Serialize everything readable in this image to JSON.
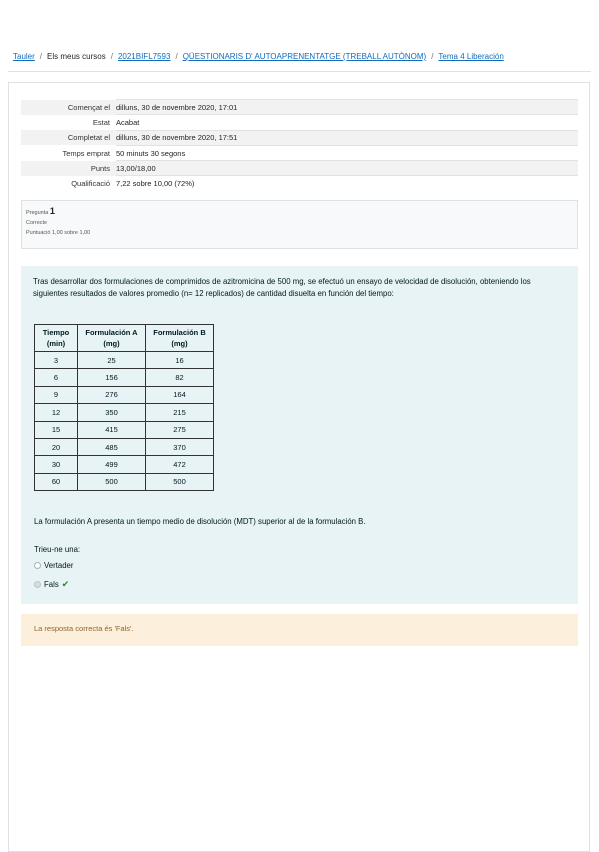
{
  "breadcrumb": {
    "items": [
      {
        "label": "Tauler",
        "link": true
      },
      {
        "label": "Els meus cursos",
        "link": false
      },
      {
        "label": "2021BIFL7593",
        "link": true
      },
      {
        "label": "QÜESTIONARIS D' AUTOAPRENENTATGE (TREBALL AUTÒNOM)",
        "link": true
      },
      {
        "label": "Tema 4 Liberación",
        "link": true
      }
    ],
    "separator": "/"
  },
  "summary": [
    {
      "label": "Començat el",
      "value": "dilluns, 30 de novembre 2020, 17:01"
    },
    {
      "label": "Estat",
      "value": "Acabat"
    },
    {
      "label": "Completat el",
      "value": "dilluns, 30 de novembre 2020, 17:51"
    },
    {
      "label": "Temps emprat",
      "value": "50 minuts 30 segons"
    },
    {
      "label": "Punts",
      "value": "13,00/18,00"
    },
    {
      "label": "Qualificació",
      "value": "7,22 sobre 10,00 (72%)"
    }
  ],
  "question_info": {
    "prefix": "Pregunta",
    "number": "1",
    "state": "Correcte",
    "grade": "Puntuació 1,00 sobre 1,00"
  },
  "question": {
    "intro": "Tras desarrollar dos formulaciones de comprimidos de azitromicina de 500 mg, se efectuó un ensayo de velocidad de disolución, obteniendo los siguientes resultados de valores promedio (n= 12 replicados) de cantidad disuelta en función del tiempo:",
    "table": {
      "headers": [
        {
          "line1": "Tiempo",
          "line2": "(min)"
        },
        {
          "line1": "Formulación A",
          "line2": "(mg)"
        },
        {
          "line1": "Formulación B",
          "line2": "(mg)"
        }
      ],
      "rows": [
        [
          "3",
          "25",
          "16"
        ],
        [
          "6",
          "156",
          "82"
        ],
        [
          "9",
          "276",
          "164"
        ],
        [
          "12",
          "350",
          "215"
        ],
        [
          "15",
          "415",
          "275"
        ],
        [
          "20",
          "485",
          "370"
        ],
        [
          "30",
          "499",
          "472"
        ],
        [
          "60",
          "500",
          "500"
        ]
      ]
    },
    "statement": "La formulación A presenta un tiempo medio de disolución (MDT) superior al de la formulación B.",
    "prompt": "Trieu-ne una:",
    "options": [
      {
        "label": "Vertader",
        "selected": false
      },
      {
        "label": "Fals",
        "selected": true,
        "correct_mark": "✔"
      }
    ]
  },
  "feedback": "La resposta correcta és 'Fals'.",
  "colors": {
    "link": "#0f6cbf",
    "question_bg": "#e7f3f5",
    "feedback_bg": "#fcefdc",
    "feedback_text": "#8e662e",
    "correct_check": "#357a32"
  }
}
